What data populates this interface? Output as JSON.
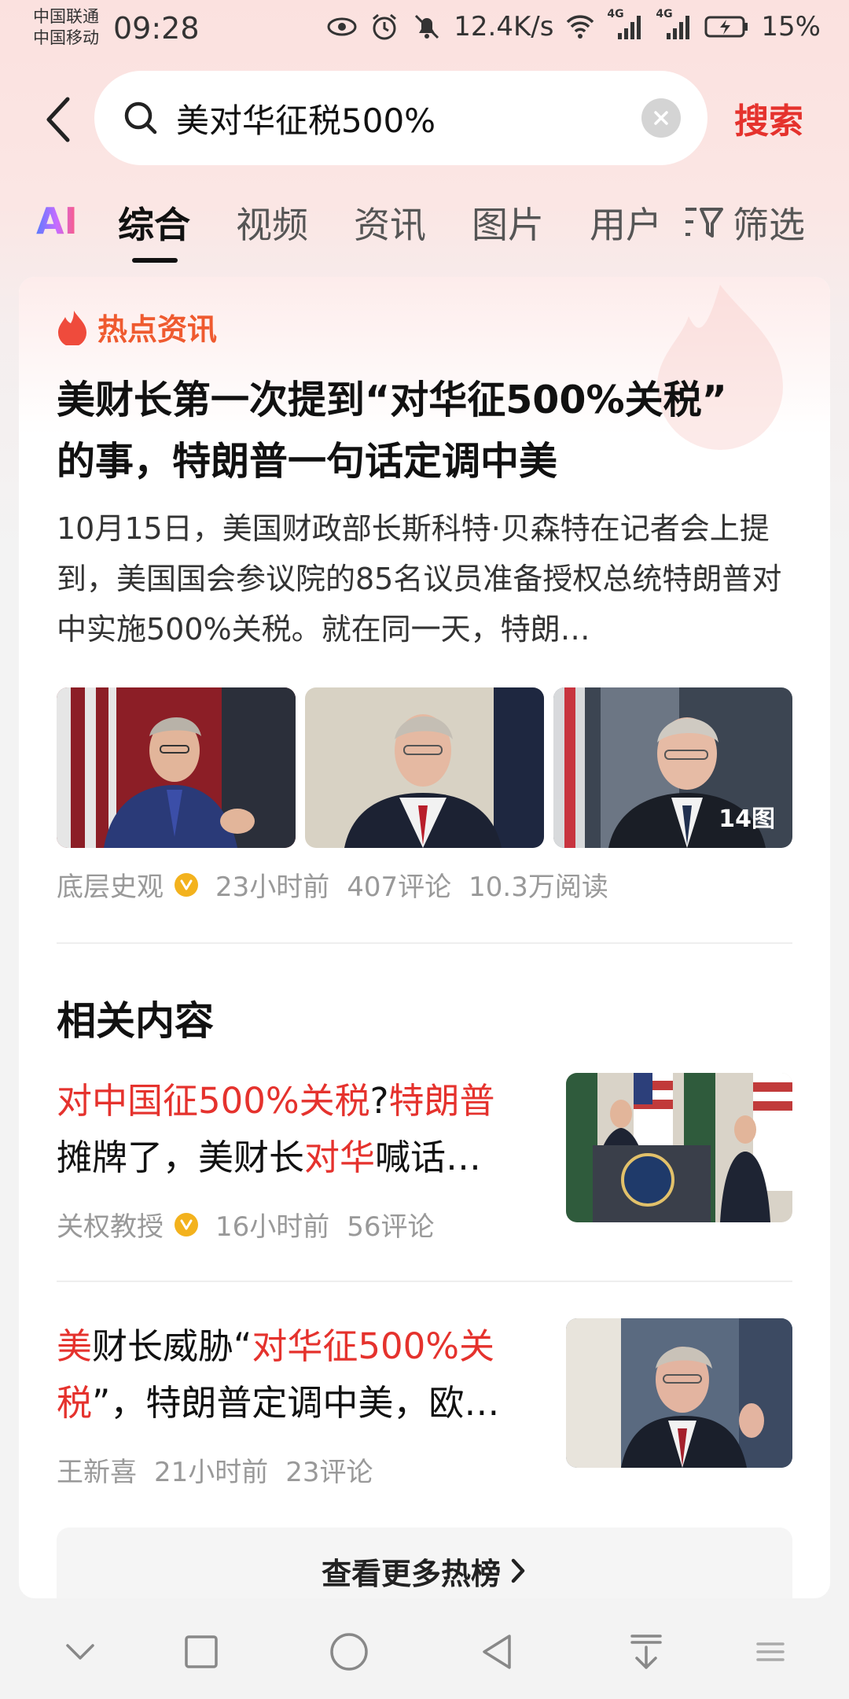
{
  "status_bar": {
    "carrier_1": "中国联通",
    "carrier_2": "中国移动",
    "time": "09:28",
    "net_speed": "12.4K/s",
    "signal_1_label": "4G",
    "signal_2_label": "4G",
    "battery": "15%"
  },
  "search": {
    "query": "美对华征税500%",
    "action_label": "搜索"
  },
  "tabs": {
    "ai_label": "AI",
    "items": [
      "综合",
      "视频",
      "资讯",
      "图片",
      "用户"
    ],
    "active_index": 0,
    "filter_label": "筛选"
  },
  "hot_news": {
    "section_label": "热点资讯",
    "headline_line1": "美财长第一次提到“对华征500%关税”",
    "headline_line2": "的事，特朗普一句话定调中美",
    "summary": "10月15日，美国财政部长斯科特·贝森特在记者会上提到，美国国会参议院的85名议员准备授权总统特朗普对中实施500%关税。就在同一天，特朗…",
    "image_count": "14图",
    "author": "底层史观",
    "time": "23小时前",
    "comments": "407评论",
    "reads": "10.3万阅读"
  },
  "related": {
    "title": "相关内容",
    "items": [
      {
        "title_seg1": "对中国征500%关税",
        "title_seg2": "?",
        "title_seg3": "特朗普",
        "title_seg4": "摊牌了，美财长",
        "title_seg5": "对华",
        "title_seg6": "喊话…",
        "author": "关权教授",
        "time": "16小时前",
        "comments": "56评论"
      },
      {
        "title_seg1": "美",
        "title_seg2": "财长威胁“",
        "title_seg3": "对华征500%关",
        "title_seg4": "税",
        "title_seg5": "”，特朗普定调中美，欧…",
        "author": "王新喜",
        "time": "21小时前",
        "comments": "23评论"
      }
    ]
  },
  "more_button": "查看更多热榜",
  "colors": {
    "accent_red": "#e5322d",
    "hot_orange": "#ef5a2f",
    "verified_yellow": "#f3b21d"
  }
}
